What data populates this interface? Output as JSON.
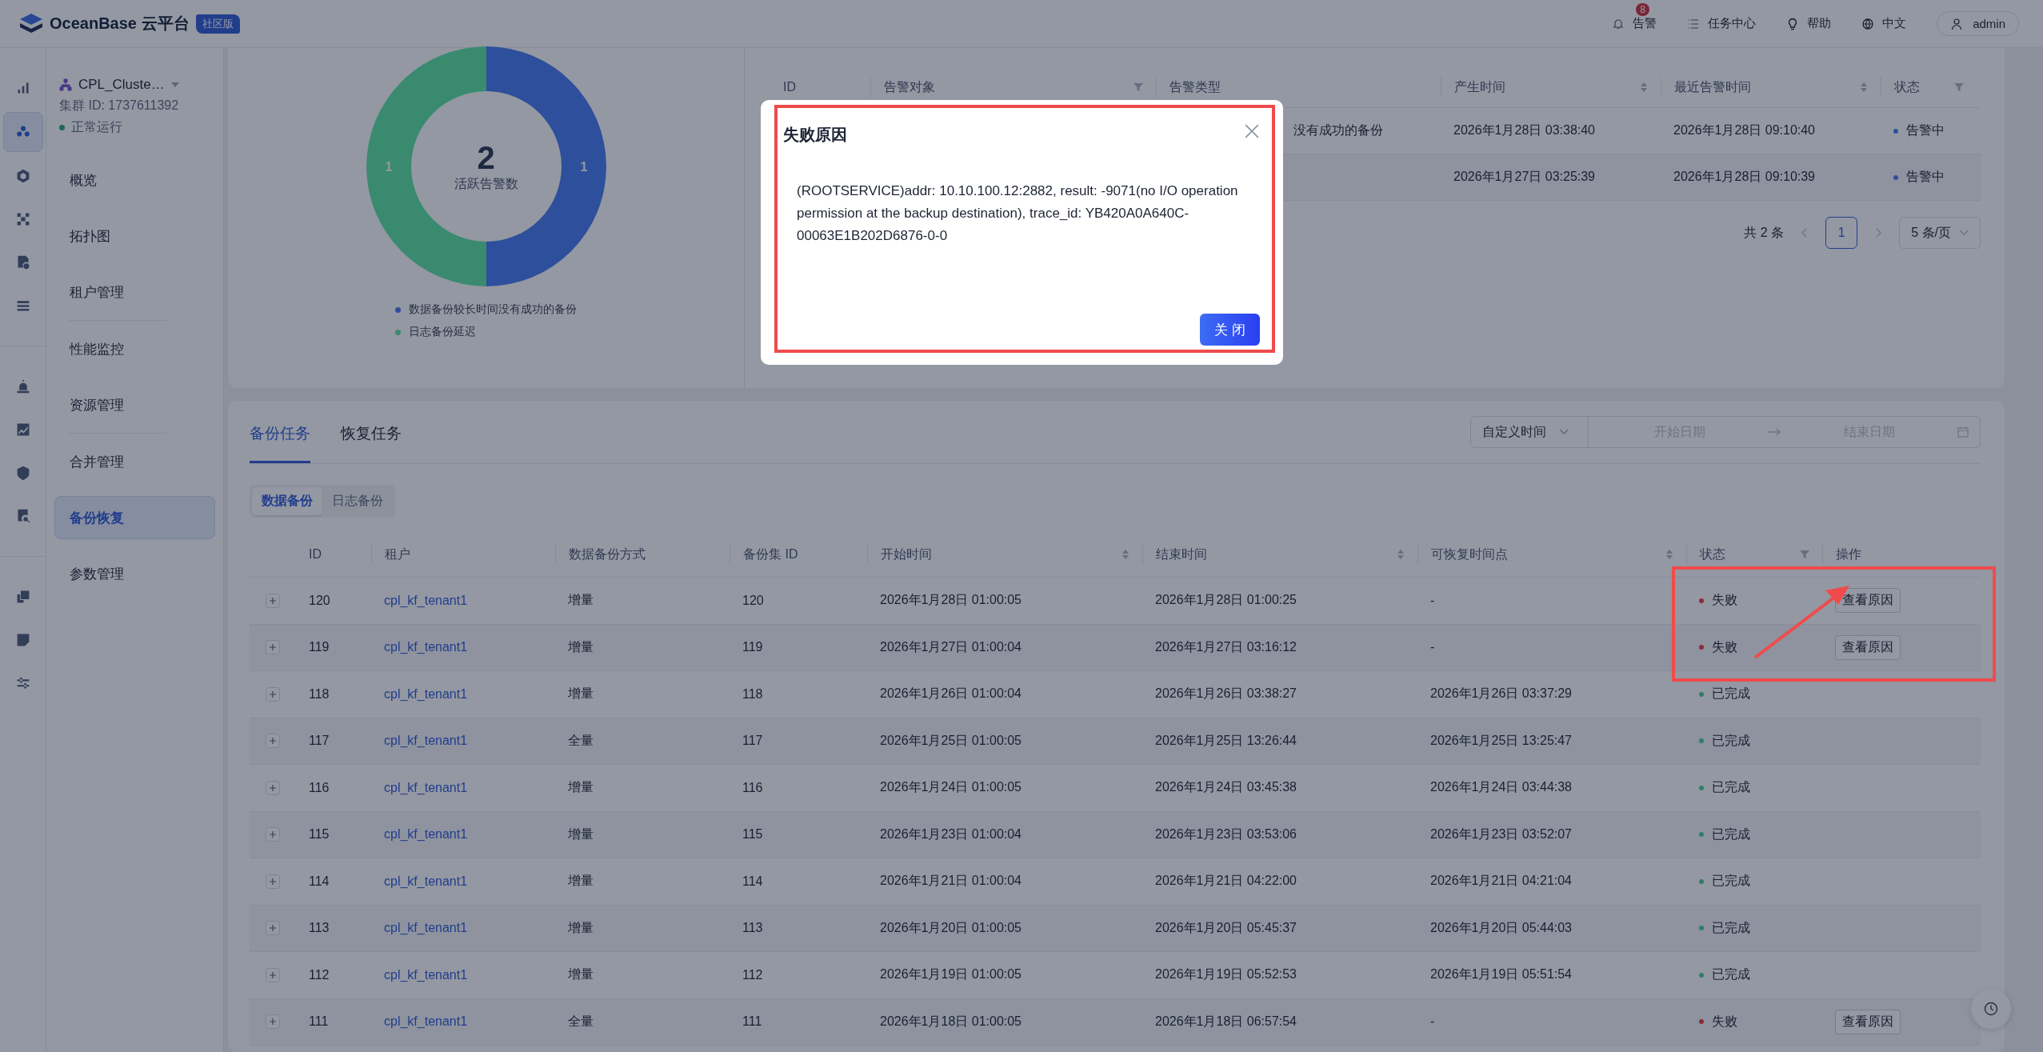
{
  "header": {
    "brand": "OceanBase 云平台",
    "edition": "社区版",
    "nav": [
      {
        "label": "告警",
        "badge": "8"
      },
      {
        "label": "任务中心"
      },
      {
        "label": "帮助"
      },
      {
        "label": "中文"
      }
    ],
    "user": "admin"
  },
  "rail": [
    [
      {
        "selected": false
      },
      {
        "selected": true
      },
      {
        "selected": false
      },
      {
        "selected": false
      },
      {
        "selected": false
      },
      {
        "selected": false
      }
    ],
    [
      {
        "selected": false
      },
      {
        "selected": false
      },
      {
        "selected": false
      },
      {
        "selected": false
      }
    ],
    [
      {
        "selected": false
      },
      {
        "selected": false
      },
      {
        "selected": false
      }
    ]
  ],
  "sidebar": {
    "cluster_name": "CPL_Cluste…",
    "cluster_id": "集群 ID: 1737611392",
    "status": "正常运行",
    "groups": [
      [
        {
          "label": "概览",
          "selected": false
        },
        {
          "label": "拓扑图",
          "selected": false
        },
        {
          "label": "租户管理",
          "selected": false
        }
      ],
      [
        {
          "label": "性能监控",
          "selected": false
        },
        {
          "label": "资源管理",
          "selected": false
        }
      ],
      [
        {
          "label": "合并管理",
          "selected": false
        },
        {
          "label": "备份恢复",
          "selected": true
        },
        {
          "label": "参数管理",
          "selected": false
        }
      ]
    ]
  },
  "alert_summary": {
    "total": "2",
    "total_label": "活跃告警数",
    "legend": [
      {
        "color": "#2e4f9c"
      },
      {
        "color": "#3a8a70"
      }
    ],
    "chart_data": {
      "type": "donut",
      "categories": [
        "数据备份较长时间没有成功的备份",
        "日志备份延迟"
      ],
      "values": [
        1,
        1
      ],
      "data_labels": true
    }
  },
  "alert_table": {
    "columns": [
      {
        "label": "ID"
      },
      {
        "label": "告警对象",
        "filter": true
      },
      {
        "label": "告警类型"
      },
      {
        "label": "产生时间",
        "sort": true
      },
      {
        "label": "最近告警时间",
        "sort": true
      },
      {
        "label": "状态",
        "filter": true
      }
    ],
    "rows": [
      {
        "type": "没有成功的备份",
        "created": "2026年1月28日 03:38:40",
        "latest": "2026年1月28日 09:10:40",
        "status": "告警中",
        "color": "#2e4f9c"
      },
      {
        "type": "",
        "created": "2026年1月27日 03:25:39",
        "latest": "2026年1月28日 09:10:39",
        "status": "告警中",
        "color": "#2e4f9c"
      }
    ],
    "pagination": {
      "total": "共 2 条",
      "pages": [
        {
          "label": "1",
          "selected": true
        }
      ],
      "page_size": "5 条/页"
    }
  },
  "tasks": {
    "tabs": [
      {
        "label": "备份任务",
        "selected": true
      },
      {
        "label": "恢复任务",
        "selected": false
      }
    ],
    "range_type": "自定义时间",
    "start_placeholder": "开始日期",
    "end_placeholder": "结束日期",
    "segments": [
      {
        "label": "数据备份",
        "selected": true
      },
      {
        "label": "日志备份",
        "selected": false
      }
    ],
    "columns": [
      {
        "label": "ID"
      },
      {
        "label": "租户"
      },
      {
        "label": "数据备份方式"
      },
      {
        "label": "备份集 ID"
      },
      {
        "label": "开始时间",
        "sort": true
      },
      {
        "label": "结束时间",
        "sort": true
      },
      {
        "label": "可恢复时间点",
        "sort": true
      },
      {
        "label": "状态",
        "filter": true
      },
      {
        "label": "操作"
      }
    ],
    "rows": [
      {
        "id": "120",
        "tenant": "cpl_kf_tenant1",
        "mode": "增量",
        "set_id": "120",
        "start": "2026年1月28日 01:00:05",
        "end": "2026年1月28日 01:00:25",
        "restore_point": "-",
        "status": "失败",
        "color": "#8f2a3a",
        "action": "查看原因"
      },
      {
        "id": "119",
        "tenant": "cpl_kf_tenant1",
        "mode": "增量",
        "set_id": "119",
        "start": "2026年1月27日 01:00:04",
        "end": "2026年1月27日 03:16:12",
        "restore_point": "-",
        "status": "失败",
        "color": "#8f2a3a",
        "action": "查看原因"
      },
      {
        "id": "118",
        "tenant": "cpl_kf_tenant1",
        "mode": "增量",
        "set_id": "118",
        "start": "2026年1月26日 01:00:04",
        "end": "2026年1月26日 03:38:27",
        "restore_point": "2026年1月26日 03:37:29",
        "status": "已完成",
        "color": "#2f7f63"
      },
      {
        "id": "117",
        "tenant": "cpl_kf_tenant1",
        "mode": "全量",
        "set_id": "117",
        "start": "2026年1月25日 01:00:05",
        "end": "2026年1月25日 13:26:44",
        "restore_point": "2026年1月25日 13:25:47",
        "status": "已完成",
        "color": "#2f7f63"
      },
      {
        "id": "116",
        "tenant": "cpl_kf_tenant1",
        "mode": "增量",
        "set_id": "116",
        "start": "2026年1月24日 01:00:05",
        "end": "2026年1月24日 03:45:38",
        "restore_point": "2026年1月24日 03:44:38",
        "status": "已完成",
        "color": "#2f7f63"
      },
      {
        "id": "115",
        "tenant": "cpl_kf_tenant1",
        "mode": "增量",
        "set_id": "115",
        "start": "2026年1月23日 01:00:04",
        "end": "2026年1月23日 03:53:06",
        "restore_point": "2026年1月23日 03:52:07",
        "status": "已完成",
        "color": "#2f7f63"
      },
      {
        "id": "114",
        "tenant": "cpl_kf_tenant1",
        "mode": "增量",
        "set_id": "114",
        "start": "2026年1月21日 01:00:04",
        "end": "2026年1月21日 04:22:00",
        "restore_point": "2026年1月21日 04:21:04",
        "status": "已完成",
        "color": "#2f7f63"
      },
      {
        "id": "113",
        "tenant": "cpl_kf_tenant1",
        "mode": "增量",
        "set_id": "113",
        "start": "2026年1月20日 01:00:05",
        "end": "2026年1月20日 05:45:37",
        "restore_point": "2026年1月20日 05:44:03",
        "status": "已完成",
        "color": "#2f7f63"
      },
      {
        "id": "112",
        "tenant": "cpl_kf_tenant1",
        "mode": "增量",
        "set_id": "112",
        "start": "2026年1月19日 01:00:05",
        "end": "2026年1月19日 05:52:53",
        "restore_point": "2026年1月19日 05:51:54",
        "status": "已完成",
        "color": "#2f7f63"
      },
      {
        "id": "111",
        "tenant": "cpl_kf_tenant1",
        "mode": "全量",
        "set_id": "111",
        "start": "2026年1月18日 01:00:05",
        "end": "2026年1月18日 06:57:54",
        "restore_point": "-",
        "status": "失败",
        "color": "#8f2a3a",
        "action": "查看原因"
      }
    ]
  },
  "dialog": {
    "title": "失败原因",
    "message": "(ROOTSERVICE)addr: 10.10.100.12:2882, result: -9071(no I/O operation permission at the backup destination), trace_id: YB420A0A640C-00063E1B202D6876-0-0",
    "button": "关 闭"
  }
}
